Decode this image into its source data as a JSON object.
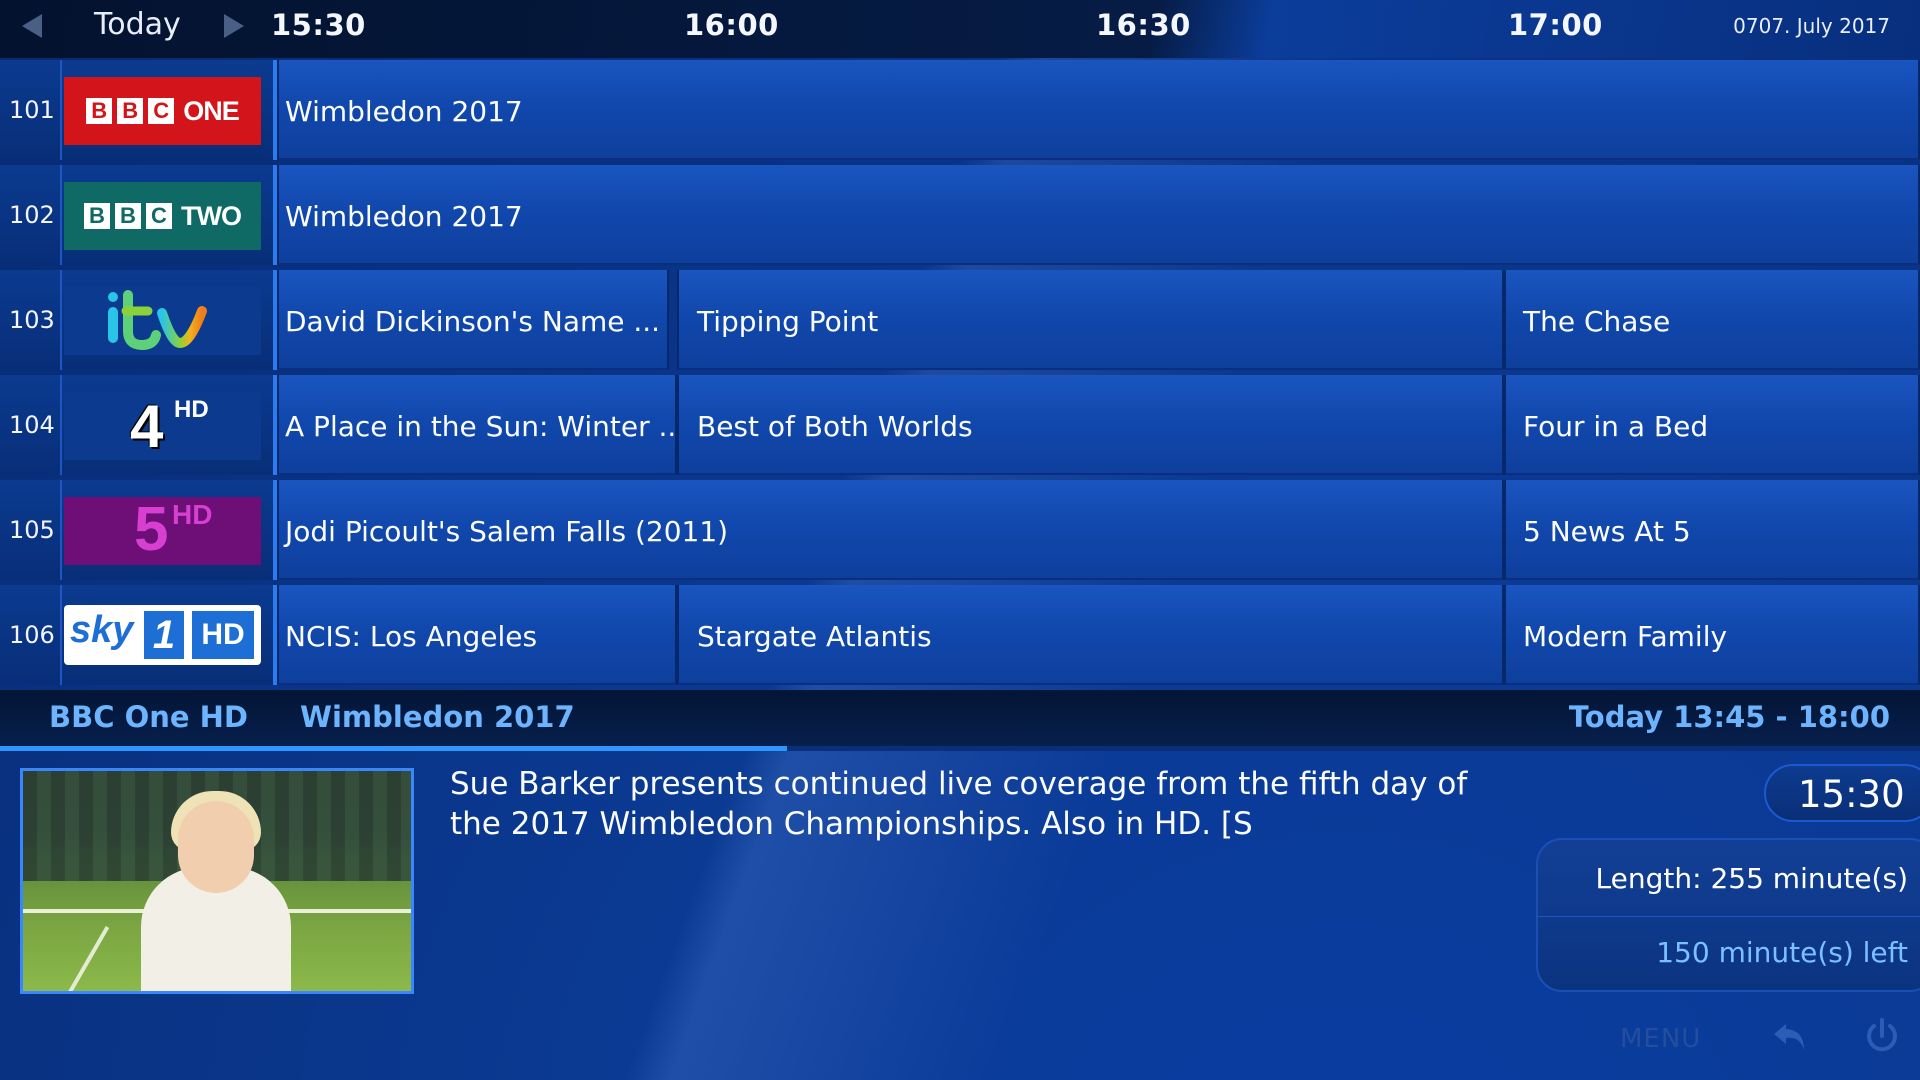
{
  "header": {
    "day_label": "Today",
    "times": [
      "15:30",
      "16:00",
      "16:30",
      "17:00"
    ],
    "date": "0707. July 2017"
  },
  "channels": [
    {
      "number": "101",
      "logo": {
        "type": "bbc",
        "letters": [
          "B",
          "B",
          "C"
        ],
        "word": "ONE",
        "bg": "#d4141b",
        "letter_color": "#d4141b"
      },
      "programs": [
        {
          "title": "Wimbledon 2017"
        }
      ]
    },
    {
      "number": "102",
      "logo": {
        "type": "bbc",
        "letters": [
          "B",
          "B",
          "C"
        ],
        "word": "TWO",
        "bg": "#0f6a66",
        "letter_color": "#0f6a66"
      },
      "programs": [
        {
          "title": "Wimbledon 2017"
        }
      ]
    },
    {
      "number": "103",
      "logo": {
        "type": "itv"
      },
      "programs": [
        {
          "title": "David Dickinson's Name ..."
        },
        {
          "title": "Tipping Point"
        },
        {
          "title": "The Chase"
        }
      ]
    },
    {
      "number": "104",
      "logo": {
        "type": "channel4",
        "text": "4",
        "suffix": "HD"
      },
      "programs": [
        {
          "title": "A Place in the Sun: Winter ..."
        },
        {
          "title": "Best of Both Worlds"
        },
        {
          "title": "Four in a Bed"
        }
      ]
    },
    {
      "number": "105",
      "logo": {
        "type": "channel5",
        "text": "5",
        "suffix": "HD",
        "bg": "#6d0f77",
        "color": "#d63fd0"
      },
      "programs": [
        {
          "title": "Jodi Picoult's Salem Falls (2011)"
        },
        {
          "title": "5 News At 5"
        }
      ]
    },
    {
      "number": "106",
      "logo": {
        "type": "sky",
        "text": "sky",
        "num": "1",
        "suffix": "HD"
      },
      "programs": [
        {
          "title": "NCIS: Los Angeles"
        },
        {
          "title": "Stargate Atlantis"
        },
        {
          "title": "Modern Family"
        }
      ]
    }
  ],
  "info": {
    "channel": "BBC One HD",
    "title": "Wimbledon 2017",
    "time": "Today 13:45 - 18:00",
    "progress_fraction": 0.41
  },
  "detail": {
    "description": "Sue Barker presents continued live coverage from the fifth day of the 2017 Wimbledon Championships. Also in HD. [S",
    "clock": "15:30",
    "length": "Length: 255 minute(s)",
    "left": "150 minute(s) left"
  },
  "footer": {
    "menu_label": "MENU"
  },
  "colors": {
    "accent": "#6db4ff",
    "program_cell": "#1148ad",
    "header_bg": "#03122e"
  }
}
